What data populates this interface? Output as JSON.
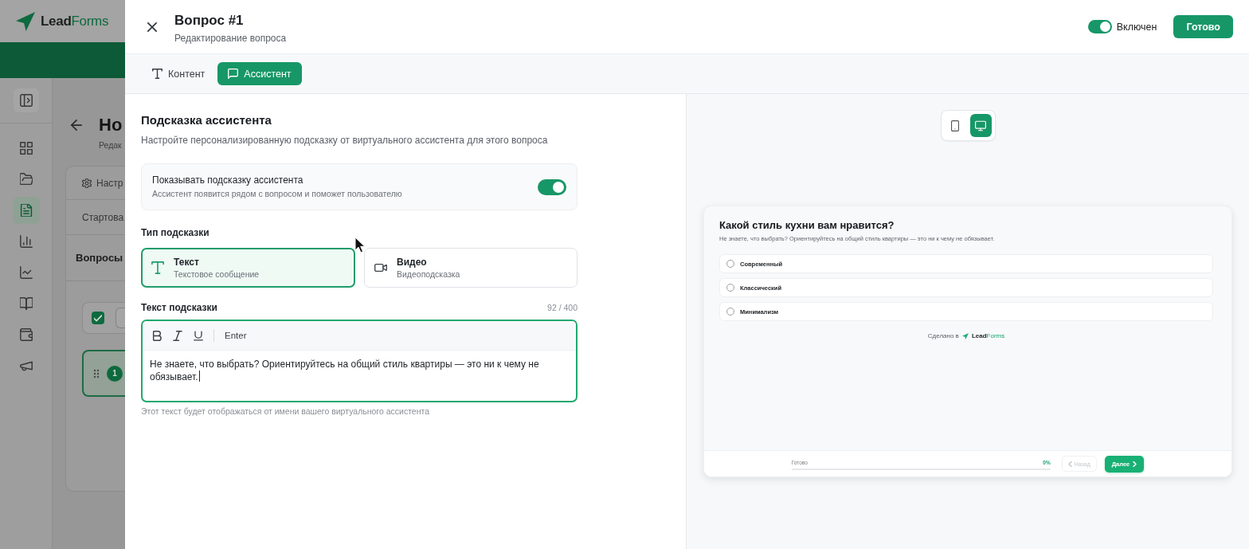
{
  "background_app": {
    "logo": {
      "text_parts": [
        "Lead",
        "Forms"
      ]
    },
    "sidebar": {
      "items": [
        {
          "selected": false
        },
        {
          "selected": false
        },
        {
          "selected": true
        },
        {
          "selected": false
        },
        {
          "selected": false
        },
        {
          "selected": false
        },
        {
          "selected": false
        },
        {
          "selected": false
        }
      ]
    },
    "page": {
      "title": "Но",
      "subtitle": "Редак"
    },
    "sections": [
      {
        "kind": "settings",
        "label": "Настр"
      },
      {
        "kind": "plain",
        "label": "Стартова"
      }
    ],
    "questions": {
      "heading": "Вопросы",
      "select_all_checked": true,
      "items": [
        {
          "number": "1",
          "selected": true
        }
      ]
    }
  },
  "drawer": {
    "header": {
      "title": "Вопрос #1",
      "subtitle": "Редактирование вопроса",
      "enabled": {
        "on": true,
        "label": "Включен"
      },
      "done_button": "Готово"
    },
    "tabs": [
      {
        "kind": "content",
        "label": "Контент",
        "selected": false
      },
      {
        "kind": "assistant",
        "label": "Ассистент",
        "selected": true
      }
    ],
    "assistant_hint": {
      "title": "Подсказка ассистента",
      "description": "Настройте персонализированную подсказку от виртуального ассистента для этого вопроса",
      "show_hint": {
        "label": "Показывать подсказку ассистента",
        "description": "Ассистент появится рядом с вопросом и поможет пользователю",
        "on": true
      },
      "type_label": "Тип подсказки",
      "types": [
        {
          "kind": "text",
          "title": "Текст",
          "subtitle": "Текстовое сообщение",
          "selected": true
        },
        {
          "kind": "video",
          "title": "Видео",
          "subtitle": "Видеоподсказка",
          "selected": false
        }
      ],
      "text_label": "Текст подсказки",
      "counter": "92 / 400",
      "editor": {
        "enter_button": "Enter",
        "value": "Не знаете, что выбрать? Ориентируйтесь на общий стиль квартиры — это ни к чему не обязывает."
      },
      "helper": "Этот текст будет отображаться от имени вашего виртуального ассистента"
    },
    "preview": {
      "devices": [
        {
          "kind": "mobile",
          "selected": false
        },
        {
          "kind": "desktop",
          "selected": true
        }
      ],
      "question": "Какой стиль кухни вам нравится?",
      "hint": "Не знаете, что выбрать? Ориентируйтесь на общий стиль квартиры — это ни к чему не обязывает.",
      "options": [
        {
          "label": "Современный",
          "selected": false
        },
        {
          "label": "Классический",
          "selected": false
        },
        {
          "label": "Минимализм",
          "selected": false
        }
      ],
      "made_with": {
        "text": "Сделано в",
        "logo_parts": [
          "Lead",
          "Forms"
        ]
      },
      "footer": {
        "progress_label": "Готово",
        "progress_value": "0%",
        "level": 0,
        "back": {
          "label": "Назад",
          "disabled": true
        },
        "next": "Далее"
      }
    }
  }
}
